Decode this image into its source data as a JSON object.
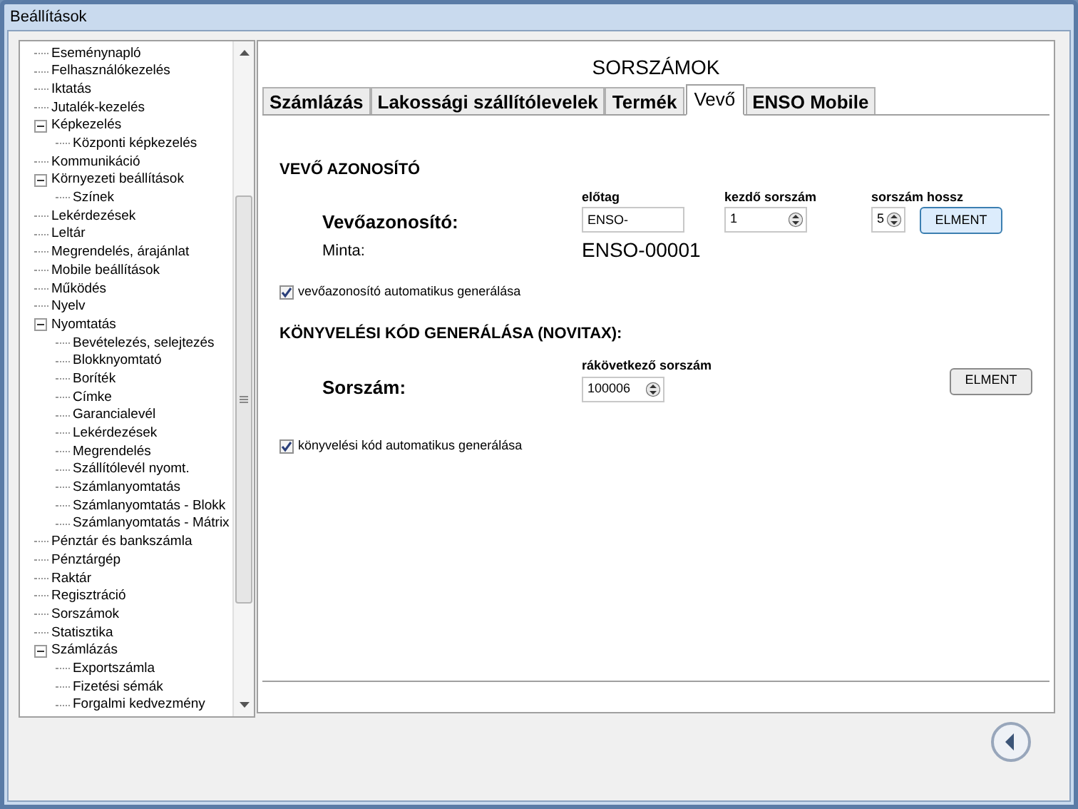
{
  "window": {
    "title": "Beállítások"
  },
  "tree": {
    "items": [
      {
        "label": "Eseménynapló"
      },
      {
        "label": "Felhasználókezelés"
      },
      {
        "label": "Iktatás"
      },
      {
        "label": "Jutalék-kezelés"
      },
      {
        "label": "Képkezelés",
        "expanded": true,
        "children": [
          {
            "label": "Központi képkezelés"
          }
        ]
      },
      {
        "label": "Kommunikáció"
      },
      {
        "label": "Környezeti beállítások",
        "expanded": true,
        "children": [
          {
            "label": "Színek"
          }
        ]
      },
      {
        "label": "Lekérdezések"
      },
      {
        "label": "Leltár"
      },
      {
        "label": "Megrendelés, árajánlat"
      },
      {
        "label": "Mobile beállítások"
      },
      {
        "label": "Működés"
      },
      {
        "label": "Nyelv"
      },
      {
        "label": "Nyomtatás",
        "expanded": true,
        "children": [
          {
            "label": "Bevételezés, selejtezés"
          },
          {
            "label": "Blokknyomtató"
          },
          {
            "label": "Boríték"
          },
          {
            "label": "Címke"
          },
          {
            "label": "Garancialevél"
          },
          {
            "label": "Lekérdezések"
          },
          {
            "label": "Megrendelés"
          },
          {
            "label": "Szállítólevél nyomt."
          },
          {
            "label": "Számlanyomtatás"
          },
          {
            "label": "Számlanyomtatás - Blokk"
          },
          {
            "label": "Számlanyomtatás - Mátrix"
          }
        ]
      },
      {
        "label": "Pénztár és bankszámla"
      },
      {
        "label": "Pénztárgép"
      },
      {
        "label": "Raktár"
      },
      {
        "label": "Regisztráció"
      },
      {
        "label": "Sorszámok"
      },
      {
        "label": "Statisztika"
      },
      {
        "label": "Számlázás",
        "expanded": true,
        "children": [
          {
            "label": "Exportszámla"
          },
          {
            "label": "Fizetési sémák"
          },
          {
            "label": "Forgalmi kedvezmény"
          }
        ]
      }
    ]
  },
  "panel": {
    "title": "SORSZÁMOK",
    "tabs": [
      {
        "label": "Számlázás",
        "selected": false
      },
      {
        "label": "Lakossági szállítólevelek",
        "selected": false
      },
      {
        "label": "Termék",
        "selected": false
      },
      {
        "label": "Vevő",
        "selected": true
      },
      {
        "label": "ENSO Mobile",
        "selected": false
      }
    ],
    "customer_id": {
      "heading": "VEVŐ AZONOSÍTÓ",
      "label": "Vevőazonosító:",
      "prefix_label": "előtag",
      "prefix_value": "ENSO-",
      "start_label": "kezdő sorszám",
      "start_value": "1",
      "length_label": "sorszám hossz",
      "length_value": "5",
      "save_button": "ELMENT",
      "sample_label": "Minta:",
      "sample_value": "ENSO-00001",
      "auto": {
        "label": "vevőazonosító automatikus generálása",
        "checked": true
      }
    },
    "accounting_code": {
      "heading": "KÖNYVELÉSI KÓD GENERÁLÁSA (NOVITAX):",
      "label": "Sorszám:",
      "next_label": "rákövetkező sorszám",
      "next_value": "100006",
      "save_button": "ELMENT",
      "auto": {
        "label": "könyvelési kód automatikus generálása",
        "checked": true
      }
    }
  }
}
